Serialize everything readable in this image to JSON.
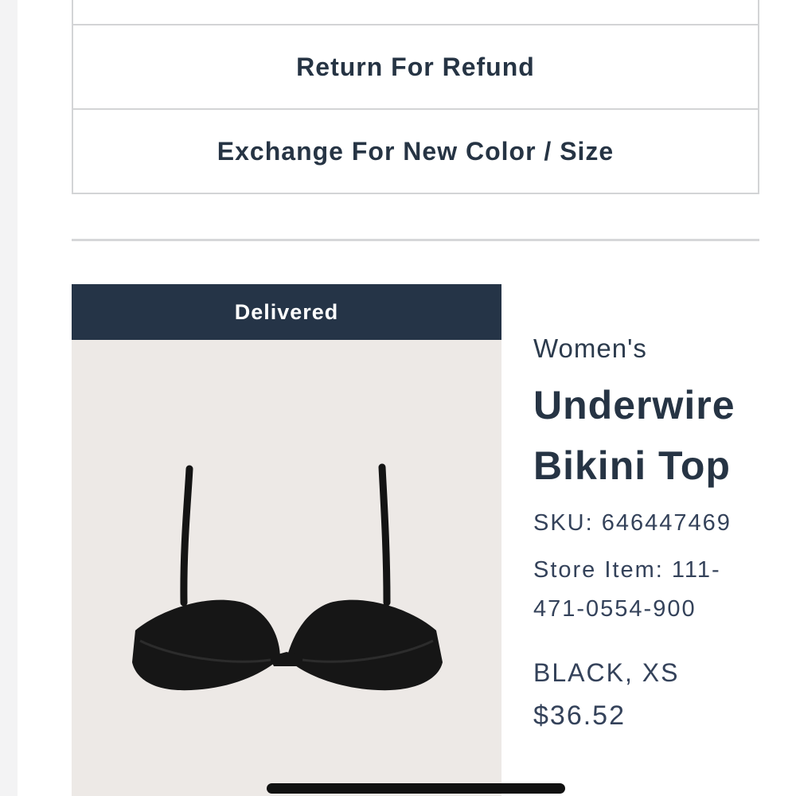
{
  "actions": {
    "return_refund_label": "Return For Refund",
    "exchange_label": "Exchange For New Color / Size"
  },
  "order_item": {
    "status_label": "Delivered",
    "category": "Women's",
    "name": "Underwire Bikini Top",
    "sku_line": "SKU: 646447469",
    "store_item_line": "Store Item: 111-471-0554-900",
    "variant": "BLACK, XS",
    "price": "$36.52",
    "image_icon": "bikini-top-product-photo"
  },
  "colors": {
    "status_bar_bg": "#253447",
    "text_primary": "#263444",
    "border": "#d3d4d6",
    "image_bg": "#ede9e6"
  }
}
